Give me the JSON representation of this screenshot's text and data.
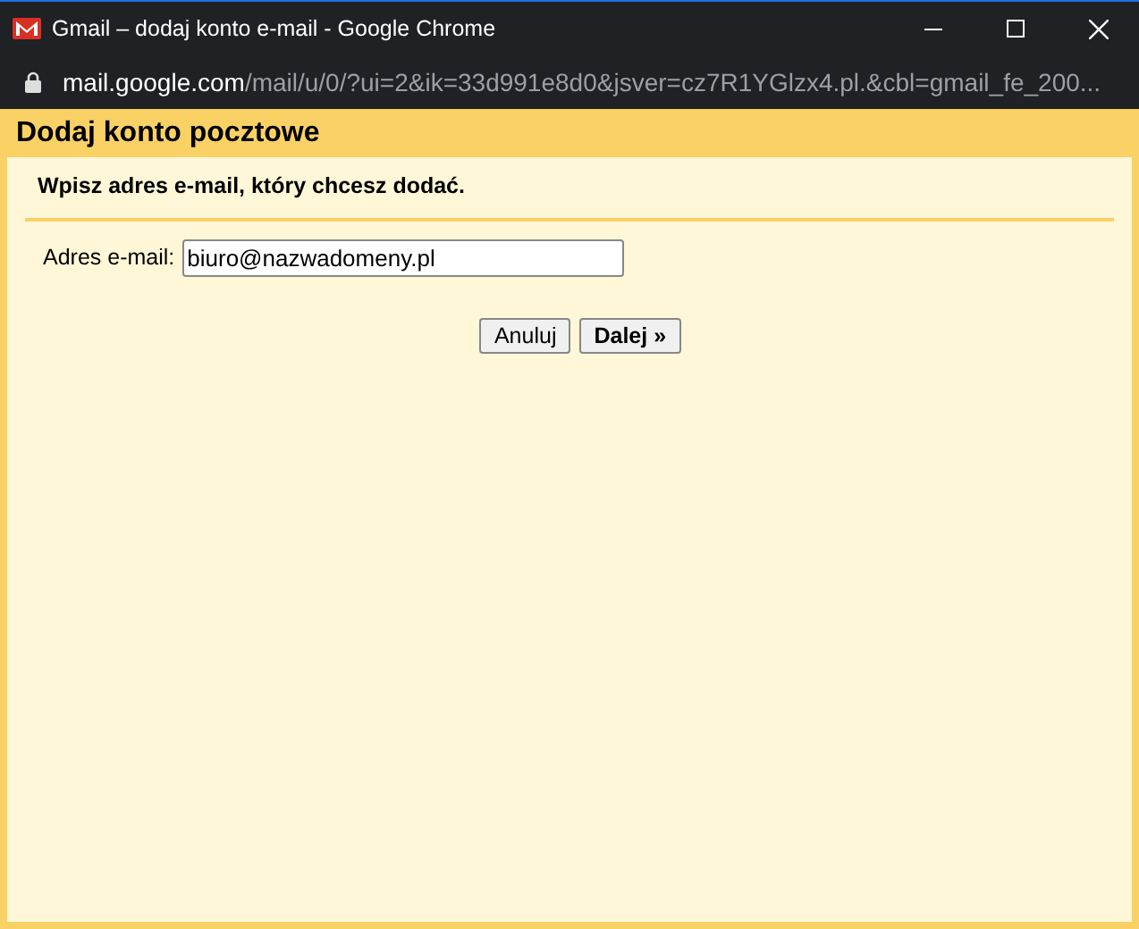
{
  "window": {
    "title": "Gmail – dodaj konto e-mail - Google Chrome"
  },
  "address_bar": {
    "domain": "mail.google.com",
    "path": "/mail/u/0/?ui=2&ik=33d991e8d0&jsver=cz7R1YGlzx4.pl.&cbl=gmail_fe_200..."
  },
  "dialog": {
    "title": "Dodaj konto pocztowe",
    "instruction": "Wpisz adres e-mail, który chcesz dodać.",
    "field": {
      "label": "Adres e-mail:",
      "value": "biuro@nazwadomeny.pl"
    },
    "buttons": [
      {
        "label": "Anuluj",
        "kind": "secondary"
      },
      {
        "label": "Dalej »",
        "kind": "primary"
      }
    ]
  }
}
